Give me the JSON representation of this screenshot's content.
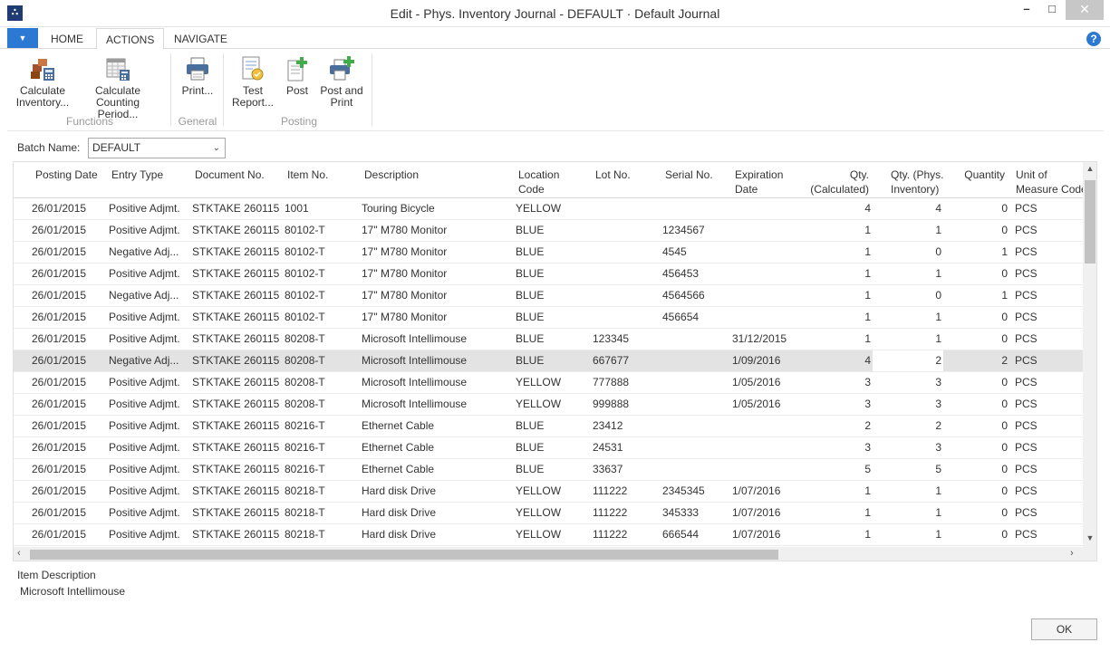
{
  "window": {
    "title": "Edit - Phys. Inventory Journal - DEFAULT · Default Journal",
    "logo_text": "∴"
  },
  "ribbon": {
    "tabs": [
      "HOME",
      "ACTIONS",
      "NAVIGATE"
    ],
    "active_tab": "ACTIONS",
    "buttons": {
      "calc_inventory": [
        "Calculate",
        "Inventory..."
      ],
      "calc_counting": [
        "Calculate",
        "Counting Period..."
      ],
      "print": [
        "Print..."
      ],
      "test_report": [
        "Test",
        "Report..."
      ],
      "post": [
        "Post"
      ],
      "post_print": [
        "Post and",
        "Print"
      ]
    },
    "groups": {
      "functions": "Functions",
      "general": "General",
      "posting": "Posting"
    }
  },
  "batch": {
    "label": "Batch Name:",
    "value": "DEFAULT"
  },
  "grid": {
    "columns": {
      "posting_date": "Posting Date",
      "entry_type": "Entry Type",
      "document_no": "Document No.",
      "item_no": "Item No.",
      "description": "Description",
      "location_1": "Location",
      "location_2": "Code",
      "lot_no": "Lot No.",
      "serial_no": "Serial No.",
      "expiration_1": "Expiration",
      "expiration_2": "Date",
      "qty_calc_1": "Qty.",
      "qty_calc_2": "(Calculated)",
      "qty_phys_1": "Qty. (Phys.",
      "qty_phys_2": "Inventory)",
      "quantity": "Quantity",
      "uom_1": "Unit of",
      "uom_2": "Measure Code"
    },
    "selected_row": 7,
    "rows": [
      {
        "date": "26/01/2015",
        "type": "Positive Adjmt.",
        "doc": "STKTAKE 260115",
        "item": "1001",
        "desc": "Touring Bicycle",
        "loc": "YELLOW",
        "lot": "",
        "serial": "",
        "exp": "",
        "qcalc": "4",
        "qphys": "4",
        "qty": "0",
        "uom": "PCS"
      },
      {
        "date": "26/01/2015",
        "type": "Positive Adjmt.",
        "doc": "STKTAKE 260115",
        "item": "80102-T",
        "desc": "17\" M780 Monitor",
        "loc": "BLUE",
        "lot": "",
        "serial": "1234567",
        "exp": "",
        "qcalc": "1",
        "qphys": "1",
        "qty": "0",
        "uom": "PCS"
      },
      {
        "date": "26/01/2015",
        "type": "Negative Adj...",
        "doc": "STKTAKE 260115",
        "item": "80102-T",
        "desc": "17\" M780 Monitor",
        "loc": "BLUE",
        "lot": "",
        "serial": "4545",
        "exp": "",
        "qcalc": "1",
        "qphys": "0",
        "qty": "1",
        "uom": "PCS"
      },
      {
        "date": "26/01/2015",
        "type": "Positive Adjmt.",
        "doc": "STKTAKE 260115",
        "item": "80102-T",
        "desc": "17\" M780 Monitor",
        "loc": "BLUE",
        "lot": "",
        "serial": "456453",
        "exp": "",
        "qcalc": "1",
        "qphys": "1",
        "qty": "0",
        "uom": "PCS"
      },
      {
        "date": "26/01/2015",
        "type": "Negative Adj...",
        "doc": "STKTAKE 260115",
        "item": "80102-T",
        "desc": "17\" M780 Monitor",
        "loc": "BLUE",
        "lot": "",
        "serial": "4564566",
        "exp": "",
        "qcalc": "1",
        "qphys": "0",
        "qty": "1",
        "uom": "PCS"
      },
      {
        "date": "26/01/2015",
        "type": "Positive Adjmt.",
        "doc": "STKTAKE 260115",
        "item": "80102-T",
        "desc": "17\" M780 Monitor",
        "loc": "BLUE",
        "lot": "",
        "serial": "456654",
        "exp": "",
        "qcalc": "1",
        "qphys": "1",
        "qty": "0",
        "uom": "PCS"
      },
      {
        "date": "26/01/2015",
        "type": "Positive Adjmt.",
        "doc": "STKTAKE 260115",
        "item": "80208-T",
        "desc": "Microsoft Intellimouse",
        "loc": "BLUE",
        "lot": "123345",
        "serial": "",
        "exp": "31/12/2015",
        "qcalc": "1",
        "qphys": "1",
        "qty": "0",
        "uom": "PCS"
      },
      {
        "date": "26/01/2015",
        "type": "Negative Adj...",
        "doc": "STKTAKE 260115",
        "item": "80208-T",
        "desc": "Microsoft Intellimouse",
        "loc": "BLUE",
        "lot": "667677",
        "serial": "",
        "exp": "1/09/2016",
        "qcalc": "4",
        "qphys": "2",
        "qty": "2",
        "uom": "PCS"
      },
      {
        "date": "26/01/2015",
        "type": "Positive Adjmt.",
        "doc": "STKTAKE 260115",
        "item": "80208-T",
        "desc": "Microsoft Intellimouse",
        "loc": "YELLOW",
        "lot": "777888",
        "serial": "",
        "exp": "1/05/2016",
        "qcalc": "3",
        "qphys": "3",
        "qty": "0",
        "uom": "PCS"
      },
      {
        "date": "26/01/2015",
        "type": "Positive Adjmt.",
        "doc": "STKTAKE 260115",
        "item": "80208-T",
        "desc": "Microsoft Intellimouse",
        "loc": "YELLOW",
        "lot": "999888",
        "serial": "",
        "exp": "1/05/2016",
        "qcalc": "3",
        "qphys": "3",
        "qty": "0",
        "uom": "PCS"
      },
      {
        "date": "26/01/2015",
        "type": "Positive Adjmt.",
        "doc": "STKTAKE 260115",
        "item": "80216-T",
        "desc": "Ethernet Cable",
        "loc": "BLUE",
        "lot": "23412",
        "serial": "",
        "exp": "",
        "qcalc": "2",
        "qphys": "2",
        "qty": "0",
        "uom": "PCS"
      },
      {
        "date": "26/01/2015",
        "type": "Positive Adjmt.",
        "doc": "STKTAKE 260115",
        "item": "80216-T",
        "desc": "Ethernet Cable",
        "loc": "BLUE",
        "lot": "24531",
        "serial": "",
        "exp": "",
        "qcalc": "3",
        "qphys": "3",
        "qty": "0",
        "uom": "PCS"
      },
      {
        "date": "26/01/2015",
        "type": "Positive Adjmt.",
        "doc": "STKTAKE 260115",
        "item": "80216-T",
        "desc": "Ethernet Cable",
        "loc": "BLUE",
        "lot": "33637",
        "serial": "",
        "exp": "",
        "qcalc": "5",
        "qphys": "5",
        "qty": "0",
        "uom": "PCS"
      },
      {
        "date": "26/01/2015",
        "type": "Positive Adjmt.",
        "doc": "STKTAKE 260115",
        "item": "80218-T",
        "desc": "Hard disk Drive",
        "loc": "YELLOW",
        "lot": "111222",
        "serial": "2345345",
        "exp": "1/07/2016",
        "qcalc": "1",
        "qphys": "1",
        "qty": "0",
        "uom": "PCS"
      },
      {
        "date": "26/01/2015",
        "type": "Positive Adjmt.",
        "doc": "STKTAKE 260115",
        "item": "80218-T",
        "desc": "Hard disk Drive",
        "loc": "YELLOW",
        "lot": "111222",
        "serial": "345333",
        "exp": "1/07/2016",
        "qcalc": "1",
        "qphys": "1",
        "qty": "0",
        "uom": "PCS"
      },
      {
        "date": "26/01/2015",
        "type": "Positive Adjmt.",
        "doc": "STKTAKE 260115",
        "item": "80218-T",
        "desc": "Hard disk Drive",
        "loc": "YELLOW",
        "lot": "111222",
        "serial": "666544",
        "exp": "1/07/2016",
        "qcalc": "1",
        "qphys": "1",
        "qty": "0",
        "uom": "PCS"
      }
    ]
  },
  "footer": {
    "item_desc_label": "Item Description",
    "item_desc_value": "Microsoft Intellimouse",
    "ok_label": "OK"
  },
  "colors": {
    "accent": "#2b79d3",
    "selected_row": "#e3e3e3"
  }
}
